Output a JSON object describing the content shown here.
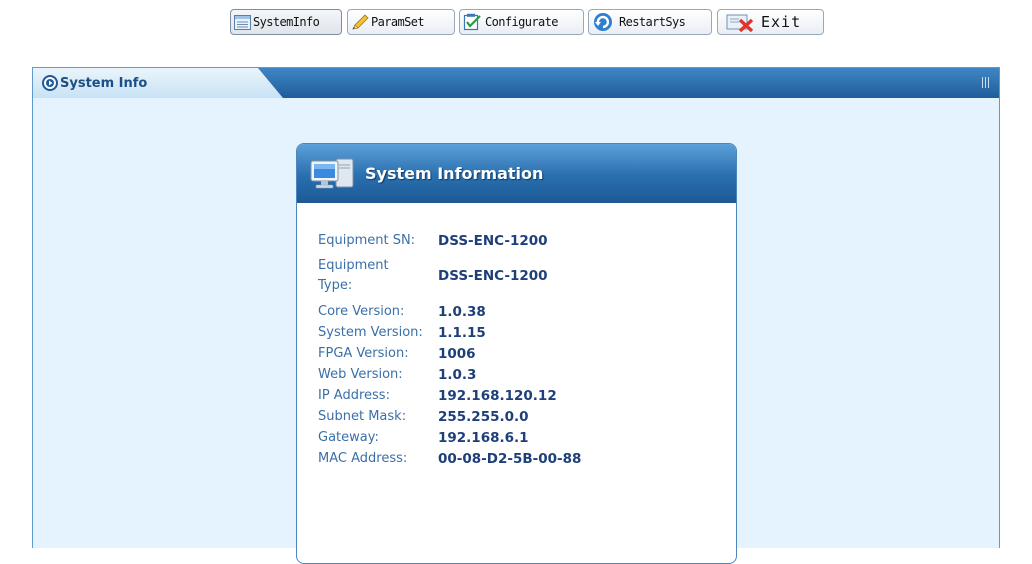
{
  "toolbar": {
    "buttons": [
      {
        "label": "SystemInfo",
        "icon": "document-list-icon",
        "active": true
      },
      {
        "label": "ParamSet",
        "icon": "pencil-icon"
      },
      {
        "label": "Configurate",
        "icon": "checklist-icon"
      },
      {
        "label": "RestartSys",
        "icon": "restart-arrow-icon"
      },
      {
        "label": "Exit",
        "icon": "exit-x-icon"
      }
    ]
  },
  "panel": {
    "tab_title": "System Info",
    "tab_icon": "circle-arrow-icon"
  },
  "card": {
    "title": "System Information",
    "icon": "computer-icon",
    "rows": [
      {
        "label": "Equipment SN:",
        "value": "DSS-ENC-1200"
      },
      {
        "label": "Equipment Type:",
        "value": "DSS-ENC-1200"
      },
      {
        "label": "Core Version:",
        "value": "1.0.38"
      },
      {
        "label": "System Version:",
        "value": "1.1.15"
      },
      {
        "label": "FPGA Version:",
        "value": "1006"
      },
      {
        "label": "Web Version:",
        "value": "1.0.3"
      },
      {
        "label": "IP Address:",
        "value": "192.168.120.12"
      },
      {
        "label": "Subnet Mask:",
        "value": "255.255.0.0"
      },
      {
        "label": "Gateway:",
        "value": "192.168.6.1"
      },
      {
        "label": "MAC Address:",
        "value": "00-08-D2-5B-00-88"
      }
    ]
  },
  "colors": {
    "header_blue": "#2a6fae",
    "panel_bg": "#e4f3fd",
    "label_text": "#3b6fa8",
    "value_text": "#1f3f7a"
  }
}
